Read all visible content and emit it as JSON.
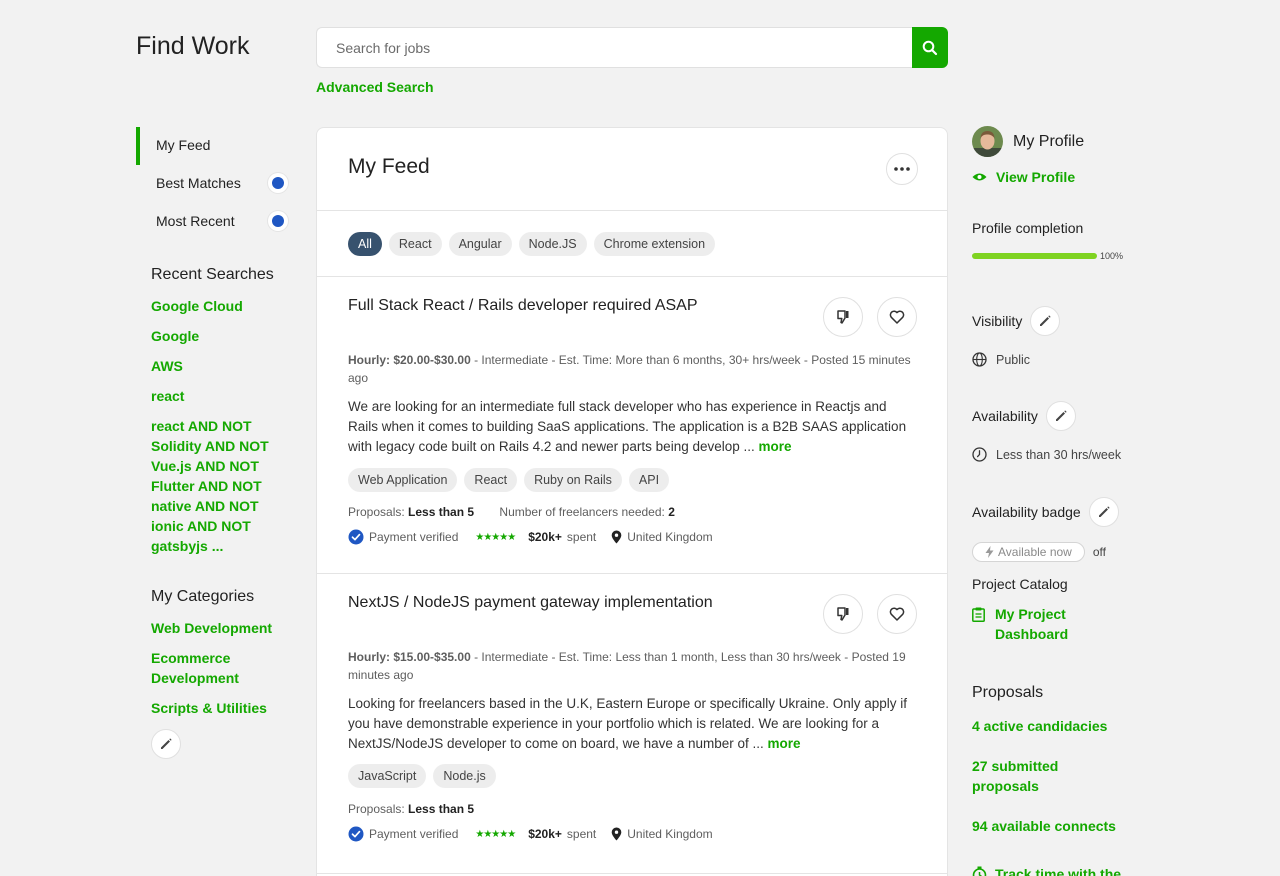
{
  "header": {
    "title": "Find Work",
    "search_placeholder": "Search for jobs",
    "advanced_search": "Advanced Search"
  },
  "nav": {
    "items": [
      {
        "label": "My Feed",
        "active": true
      },
      {
        "label": "Best Matches"
      },
      {
        "label": "Most Recent"
      }
    ]
  },
  "recent_searches": {
    "heading": "Recent Searches",
    "items": [
      "Google Cloud",
      "Google",
      "AWS",
      "react"
    ],
    "compound": [
      "react AND NOT",
      "Solidity AND NOT",
      "Vue.js AND NOT",
      "Flutter AND NOT",
      "native AND NOT",
      "ionic AND NOT",
      "gatsbyjs ..."
    ]
  },
  "categories": {
    "heading": "My Categories",
    "items": [
      "Web Development",
      "Ecommerce Development",
      "Scripts & Utilities"
    ]
  },
  "feed": {
    "title": "My Feed",
    "filters": [
      "All",
      "React",
      "Angular",
      "Node.JS",
      "Chrome extension"
    ],
    "jobs": [
      {
        "title": "Full Stack React / Rails developer required ASAP",
        "rate": "Hourly: $20.00-$30.00",
        "meta": " - Intermediate - Est. Time: More than 6 months, 30+ hrs/week - Posted 15 minutes ago",
        "desc": "We are looking for an intermediate full stack developer who has experience in Reactjs and Rails when it comes to building SaaS applications. The application is a B2B SAAS application with legacy code built on Rails 4.2 and newer parts being develop ...",
        "more": "more",
        "skills": [
          "Web Application",
          "React",
          "Ruby on Rails",
          "API"
        ],
        "proposals_label": "Proposals:",
        "proposals_value": "Less than 5",
        "needed_label": "Number of freelancers needed:",
        "needed_value": "2",
        "payment": "Payment verified",
        "spent": "$20k+",
        "spent_label": "spent",
        "location": "United Kingdom"
      },
      {
        "title": "NextJS / NodeJS payment gateway implementation",
        "rate": "Hourly: $15.00-$35.00",
        "meta": " - Intermediate - Est. Time: Less than 1 month, Less than 30 hrs/week - Posted 19 minutes ago",
        "desc": "Looking for freelancers based in the U.K, Eastern Europe or specifically Ukraine. Only apply if you have demonstrable experience in your portfolio which is related. We are looking for a NextJS/NodeJS developer to come on board, we have a number of ...",
        "more": "more",
        "skills": [
          "JavaScript",
          "Node.js"
        ],
        "proposals_label": "Proposals:",
        "proposals_value": "Less than 5",
        "payment": "Payment verified",
        "spent": "$20k+",
        "spent_label": "spent",
        "location": "United Kingdom"
      }
    ]
  },
  "profile": {
    "title": "My Profile",
    "view": "View Profile",
    "completion_label": "Profile completion",
    "completion_pct": 100,
    "completion_text": "100%",
    "visibility_label": "Visibility",
    "visibility_value": "Public",
    "availability_label": "Availability",
    "availability_value": "Less than 30 hrs/week",
    "badge_label": "Availability badge",
    "badge_pill": "Available now",
    "badge_state": "off",
    "catalog_label": "Project Catalog",
    "catalog_link": "My Project Dashboard"
  },
  "proposals": {
    "heading": "Proposals",
    "active": "4 active candidacies",
    "submitted": "27 submitted proposals",
    "connects": "94 available connects",
    "track": "Track time with the"
  },
  "colors": {
    "brand": "#14a800",
    "progress": "#7fd321",
    "verified": "#1f57c3",
    "active_pill": "#37526e"
  }
}
